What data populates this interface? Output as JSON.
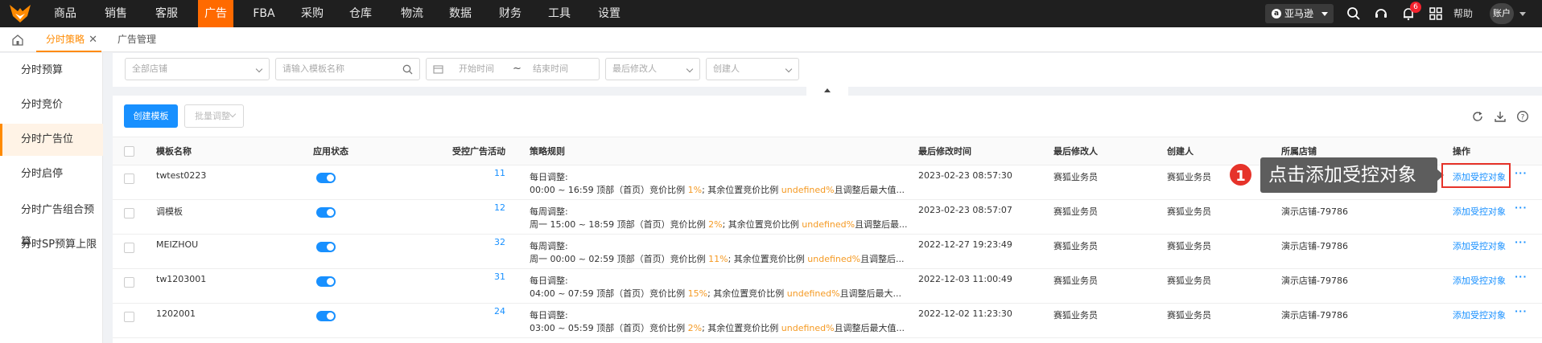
{
  "topnav": {
    "items": [
      "商品",
      "销售",
      "客服",
      "广告",
      "FBA",
      "采购",
      "仓库",
      "物流",
      "数据",
      "财务",
      "工具",
      "设置"
    ],
    "active": "广告",
    "market": "亚马逊",
    "notification_count": "6",
    "help": "帮助",
    "account": "账户"
  },
  "tabs": {
    "active_tab": "分时策略",
    "close": "✕",
    "second_tab": "广告管理"
  },
  "sidebar": {
    "items": [
      "分时预算",
      "分时竞价",
      "分时广告位",
      "分时启停",
      "分时广告组合预算",
      "分时SP预算上限"
    ],
    "active": "分时广告位"
  },
  "filters": {
    "store": "全部店铺",
    "template_placeholder": "请输入模板名称",
    "start_time": "开始时间",
    "tilde": "~",
    "end_time": "结束时间",
    "last_modifier": "最后修改人",
    "creator": "创建人"
  },
  "toolbar": {
    "create": "创建模板",
    "batch": "批量调整"
  },
  "table": {
    "headers": {
      "name": "模板名称",
      "status": "应用状态",
      "controlled": "受控广告活动",
      "rule": "策略规则",
      "modified_time": "最后修改时间",
      "modifier": "最后修改人",
      "creator": "创建人",
      "store": "所属店铺",
      "action": "操作"
    },
    "rows": [
      {
        "name": "twtest0223",
        "controlled": "11",
        "rule_line1": "每日调整:",
        "rule_time": "00:00 ~ 16:59 顶部（首页）竞价比例 ",
        "rule_pct": "1%",
        "rule_mid": "; 其余位置竞价比例 ",
        "rule_undef": "undefined%",
        "rule_tail": "且调整后最大值...",
        "modified_time": "2023-02-23 08:57:30",
        "modifier": "赛狐业务员",
        "creator": "赛狐业务员",
        "store": "",
        "action": "添加受控对象",
        "more": "···"
      },
      {
        "name": "调模板",
        "controlled": "12",
        "rule_line1": "每周调整:",
        "rule_time": "周一 15:00 ~ 18:59 顶部（首页）竞价比例 ",
        "rule_pct": "2%",
        "rule_mid": "; 其余位置竞价比例 ",
        "rule_undef": "undefined%",
        "rule_tail": "且调整后最...",
        "modified_time": "2023-02-23 08:57:07",
        "modifier": "赛狐业务员",
        "creator": "赛狐业务员",
        "store": "演示店铺-79786",
        "action": "添加受控对象",
        "more": "···"
      },
      {
        "name": "MEIZHOU",
        "controlled": "32",
        "rule_line1": "每周调整:",
        "rule_time": "周一 00:00 ~ 02:59 顶部（首页）竞价比例 ",
        "rule_pct": "11%",
        "rule_mid": "; 其余位置竞价比例 ",
        "rule_undef": "undefined%",
        "rule_tail": "且调整后...",
        "modified_time": "2022-12-27 19:23:49",
        "modifier": "赛狐业务员",
        "creator": "赛狐业务员",
        "store": "演示店铺-79786",
        "action": "添加受控对象",
        "more": "···"
      },
      {
        "name": "tw1203001",
        "controlled": "31",
        "rule_line1": "每日调整:",
        "rule_time": "04:00 ~ 07:59 顶部（首页）竞价比例 ",
        "rule_pct": "15%",
        "rule_mid": "; 其余位置竞价比例 ",
        "rule_undef": "undefined%",
        "rule_tail": "且调整后最大...",
        "modified_time": "2022-12-03 11:00:49",
        "modifier": "赛狐业务员",
        "creator": "赛狐业务员",
        "store": "演示店铺-79786",
        "action": "添加受控对象",
        "more": "···"
      },
      {
        "name": "1202001",
        "controlled": "24",
        "rule_line1": "每日调整:",
        "rule_time": "03:00 ~ 05:59 顶部（首页）竞价比例 ",
        "rule_pct": "2%",
        "rule_mid": "; 其余位置竞价比例 ",
        "rule_undef": "undefined%",
        "rule_tail": "且调整后最大值...",
        "modified_time": "2022-12-02 11:23:30",
        "modifier": "赛狐业务员",
        "creator": "赛狐业务员",
        "store": "演示店铺-79786",
        "action": "添加受控对象",
        "more": "···"
      }
    ]
  },
  "tooltip": {
    "step": "1",
    "text": "点击添加受控对象"
  },
  "colors": {
    "accent": "#ff6a00",
    "primary": "#1890ff",
    "highlight": "#e6332a"
  }
}
